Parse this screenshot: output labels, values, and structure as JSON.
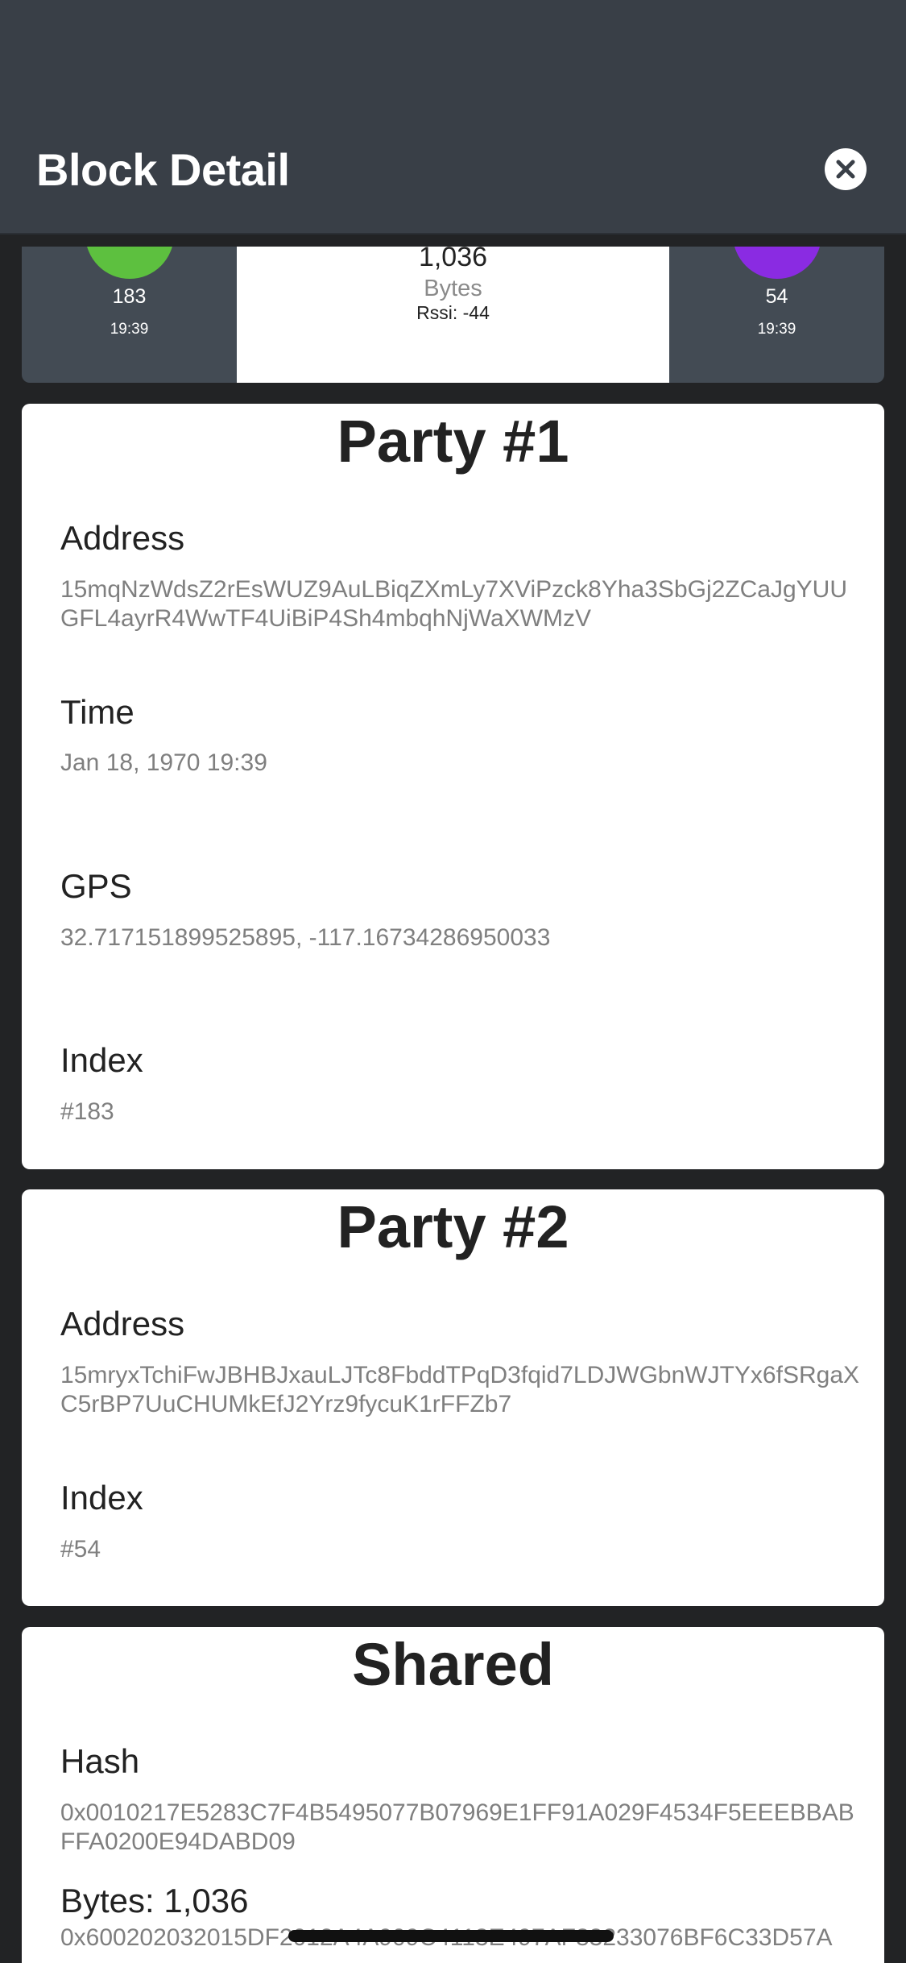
{
  "header": {
    "title": "Block Detail",
    "close_icon": "close-icon"
  },
  "summary": {
    "party1": {
      "number": "183",
      "time": "19:39",
      "color": "#5dc03f"
    },
    "center": {
      "bytes": "1,036",
      "unit": "Bytes",
      "rssi": "Rssi: -44"
    },
    "party2": {
      "number": "54",
      "time": "19:39",
      "color": "#8a2be2"
    }
  },
  "party1": {
    "title": "Party #1",
    "address_label": "Address",
    "address_value": "15mqNzWdsZ2rEsWUZ9AuLBiqZXmLy7XViPzck8Yha3SbGj2ZCaJgYUUGFL4ayrR4WwTF4UiBiP4Sh4mbqhNjWaXWMzV",
    "time_label": "Time",
    "time_value": "Jan 18, 1970 19:39",
    "gps_label": "GPS",
    "gps_value": "32.717151899525895, -117.16734286950033",
    "index_label": "Index",
    "index_value": "#183"
  },
  "party2": {
    "title": "Party #2",
    "address_label": "Address",
    "address_value": "15mryxTchiFwJBHBJxauLJTc8FbddTPqD3fqid7LDJWGbnWJTYx6fSRgaXC5rBP7UuCHUMkEfJ2Yrz9fycuK1rFFZb7",
    "index_label": "Index",
    "index_value": "#54"
  },
  "shared": {
    "title": "Shared",
    "hash_label": "Hash",
    "hash_value": "0x0010217E5283C7F4B5495077B07969E1FF91A029F4534F5EEEBBABFFA0200E94DABD09",
    "bytes_label": "Bytes: 1,036",
    "bytes_value": "0x600202032015DF2012A4A909C4113E497AF83233076BF6C33D57A"
  }
}
